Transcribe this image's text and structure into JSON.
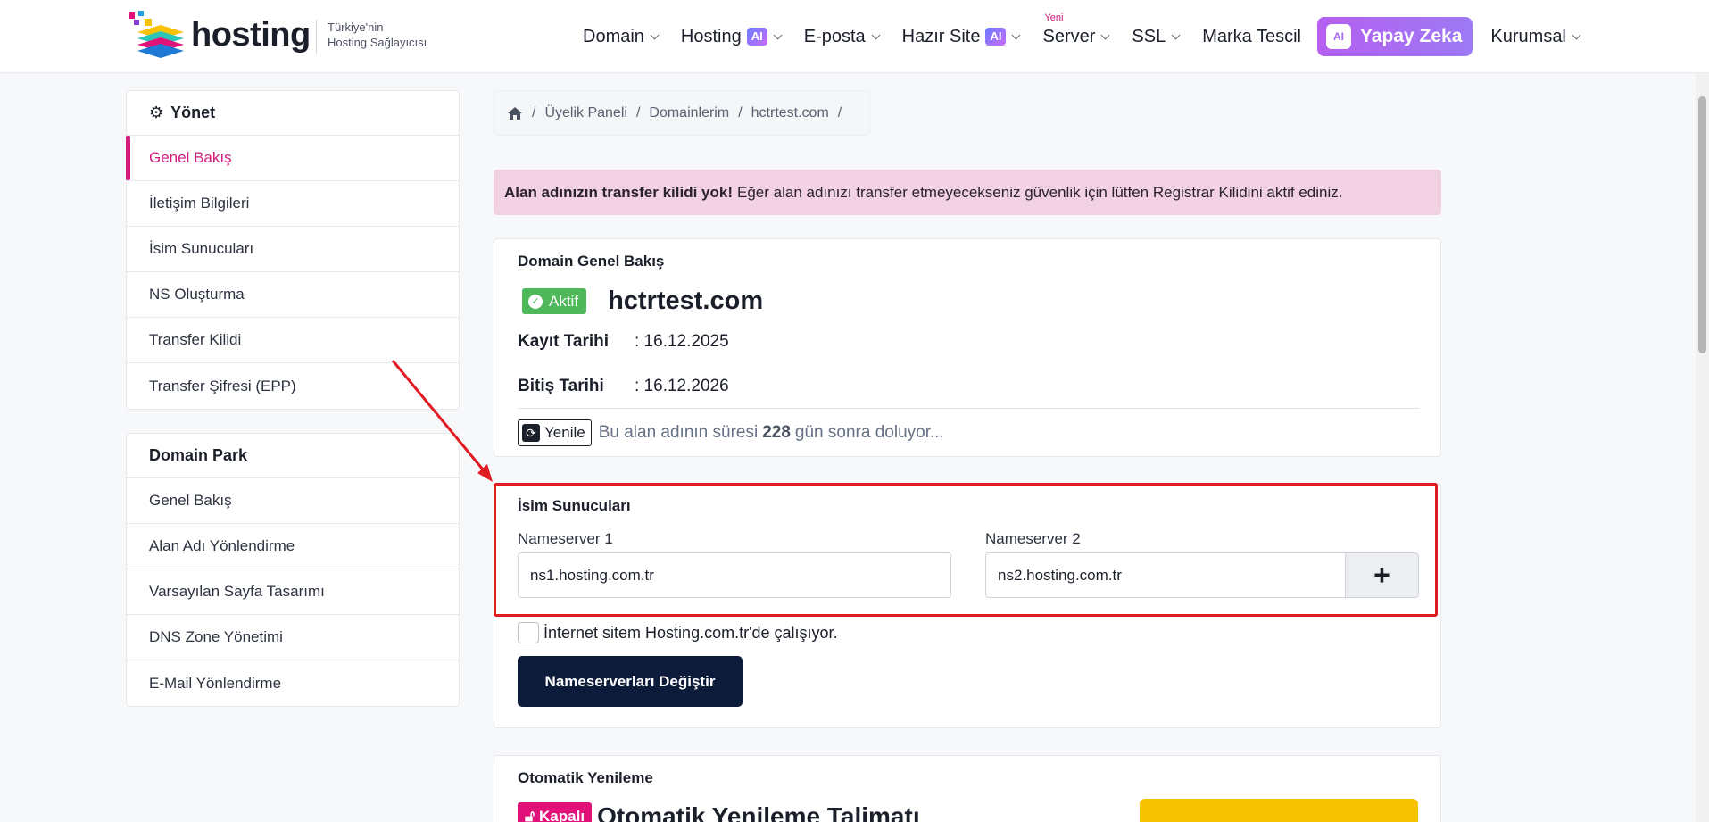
{
  "header": {
    "logo_text": "hosting",
    "tagline_line1": "Türkiye'nin",
    "tagline_line2": "Hosting Sağlayıcısı",
    "nav": [
      {
        "label": "Domain"
      },
      {
        "label": "Hosting",
        "badge": "AI"
      },
      {
        "label": "E-posta"
      },
      {
        "label": "Hazır Site",
        "badge": "AI"
      },
      {
        "label": "Server",
        "new": "Yeni"
      },
      {
        "label": "SSL"
      },
      {
        "label": "Marka Tescil"
      },
      {
        "label": "Yapay Zeka",
        "ai_icon": "AI"
      },
      {
        "label": "Kurumsal"
      }
    ]
  },
  "sidebar": {
    "manage": {
      "title": "Yönet",
      "items": [
        "Genel Bakış",
        "İletişim Bilgileri",
        "İsim Sunucuları",
        "NS Oluşturma",
        "Transfer Kilidi",
        "Transfer Şifresi (EPP)"
      ]
    },
    "park": {
      "title": "Domain Park",
      "items": [
        "Genel Bakış",
        "Alan Adı Yönlendirme",
        "Varsayılan Sayfa Tasarımı",
        "DNS Zone Yönetimi",
        "E-Mail Yönlendirme"
      ]
    }
  },
  "breadcrumb": [
    "Üyelik Paneli",
    "Domainlerim",
    "hctrtest.com"
  ],
  "alert": {
    "bold": "Alan adınızın transfer kilidi yok!",
    "text": "Eğer alan adınızı transfer etmeyecekseniz güvenlik için lütfen Registrar Kilidini aktif ediniz."
  },
  "overview": {
    "title": "Domain Genel Bakış",
    "status": "Aktif",
    "domain": "hctrtest.com",
    "reg_label": "Kayıt Tarihi",
    "reg_value": ": 16.12.2025",
    "exp_label": "Bitiş Tarihi",
    "exp_value": ": 16.12.2026",
    "renew_label": "Yenile",
    "remaining_pre": "Bu alan adının süresi",
    "remaining_days": "228",
    "remaining_post": "gün sonra doluyor..."
  },
  "nameservers": {
    "title": "İsim Sunucuları",
    "ns1_label": "Nameserver 1",
    "ns1_value": "ns1.hosting.com.tr",
    "ns2_label": "Nameserver 2",
    "ns2_value": "ns2.hosting.com.tr",
    "add_label": "+",
    "checkbox_label": "İnternet sitem Hosting.com.tr'de çalışıyor.",
    "submit_label": "Nameserverları Değiştir"
  },
  "auto_renew": {
    "title": "Otomatik Yenileme",
    "status": "Kapalı",
    "heading": "Otomatik Yenileme Talimatı"
  },
  "colors": {
    "accent_pink": "#d21b7d",
    "active_green": "#4fb85b",
    "primary_navy": "#0d1b3a",
    "annotation_red": "#e11b22",
    "alert_bg": "#f2d1e2"
  }
}
